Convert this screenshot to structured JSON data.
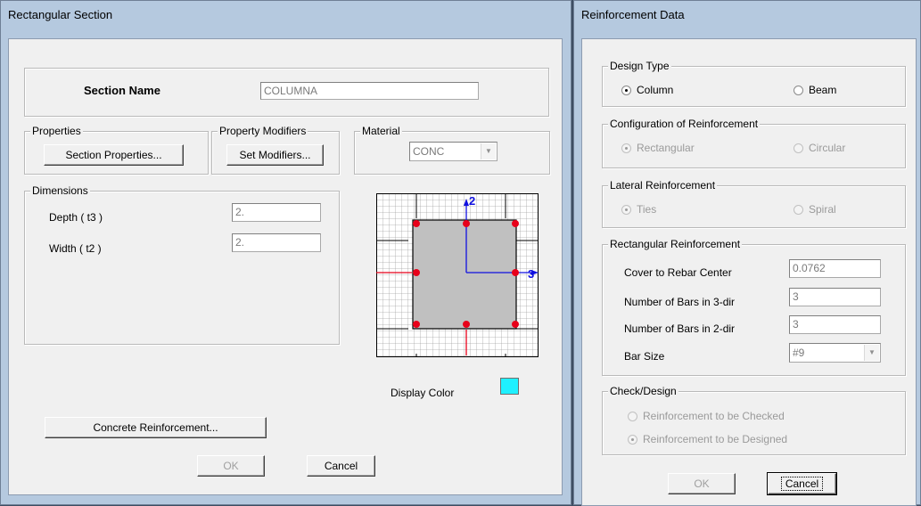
{
  "rect_dialog": {
    "title": "Rectangular Section",
    "section_name_label": "Section Name",
    "section_name_value": "COLUMNA",
    "properties": {
      "group_label": "Properties",
      "button_label": "Section Properties..."
    },
    "property_modifiers": {
      "group_label": "Property Modifiers",
      "button_label": "Set Modifiers..."
    },
    "material": {
      "group_label": "Material",
      "selected": "CONC"
    },
    "dimensions": {
      "group_label": "Dimensions",
      "depth_label": "Depth  ( t3 )",
      "depth_value": "2.",
      "width_label": "Width  ( t2 )",
      "width_value": "2."
    },
    "preview": {
      "axis_vertical_label": "2",
      "axis_horizontal_label": "3"
    },
    "display_color_label": "Display Color",
    "display_color": "#1ff0ff",
    "concrete_button_label": "Concrete Reinforcement...",
    "ok_label": "OK",
    "cancel_label": "Cancel"
  },
  "reinf_dialog": {
    "title": "Reinforcement Data",
    "design_type": {
      "group_label": "Design Type",
      "column_label": "Column",
      "beam_label": "Beam",
      "selected": "Column"
    },
    "configuration": {
      "group_label": "Configuration of Reinforcement",
      "rectangular_label": "Rectangular",
      "circular_label": "Circular",
      "selected": "Rectangular"
    },
    "lateral": {
      "group_label": "Lateral Reinforcement",
      "ties_label": "Ties",
      "spiral_label": "Spiral",
      "selected": "Ties"
    },
    "rectangular_reinf": {
      "group_label": "Rectangular Reinforcement",
      "cover_label": "Cover to Rebar Center",
      "cover_value": "0.0762",
      "bars3_label": "Number of Bars in 3-dir",
      "bars3_value": "3",
      "bars2_label": "Number of Bars in 2-dir",
      "bars2_value": "3",
      "barsize_label": "Bar Size",
      "barsize_value": "#9"
    },
    "check_design": {
      "group_label": "Check/Design",
      "checked_label": "Reinforcement to be Checked",
      "designed_label": "Reinforcement to be Designed",
      "selected": "Reinforcement to be Designed"
    },
    "ok_label": "OK",
    "cancel_label": "Cancel"
  },
  "colors": {
    "rebar": "#e8001a",
    "axis": "#1010e0",
    "section_fill": "#c0c0c0",
    "frame": "#b5c9df"
  }
}
